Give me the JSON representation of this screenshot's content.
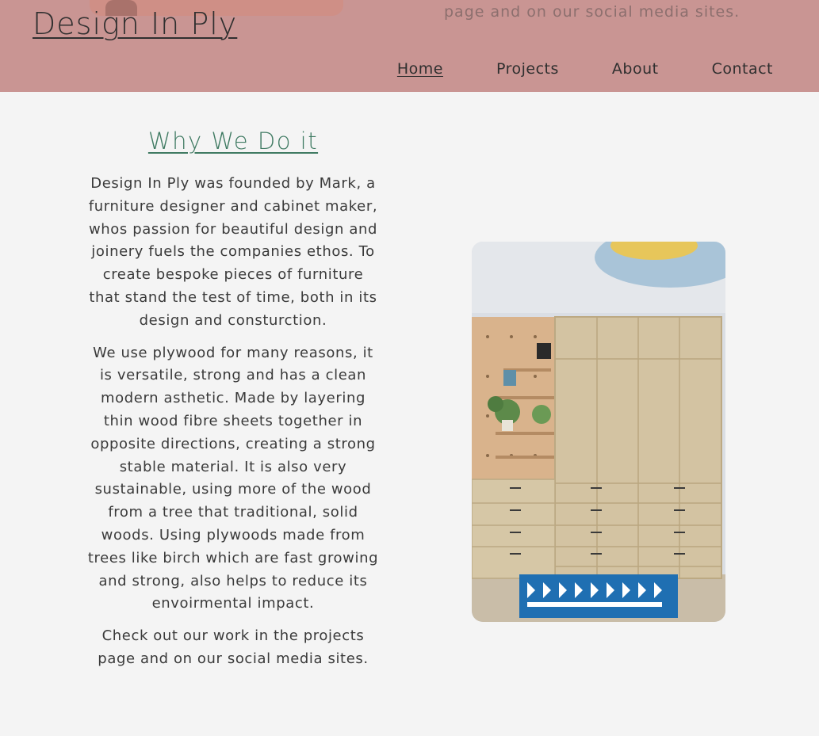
{
  "header": {
    "logo": "Design In Ply",
    "overflow_text": "page and on our social media sites.",
    "nav": [
      {
        "label": "Home",
        "active": true
      },
      {
        "label": "Projects",
        "active": false
      },
      {
        "label": "About",
        "active": false
      },
      {
        "label": "Contact",
        "active": false
      }
    ]
  },
  "main": {
    "title": "Why We Do it",
    "paragraphs": [
      "Design In Ply was founded by Mark, a furniture designer and cabinet maker, whos passion for beautiful design and joinery fuels the companies ethos. To create bespoke pieces of furniture that stand the test of time, both in its design and consturction.",
      "We use plywood for many reasons, it is versatile, strong and has a clean modern asthetic. Made by layering thin wood fibre sheets together in opposite directions, creating a strong stable material. It is also very sustainable, using more of the wood from a tree that traditional, solid woods. Using plywoods made from trees like birch which are fast growing and strong, also helps to reduce its envoirmental impact.",
      "Check out our work in the projects page and on our social media sites."
    ],
    "photo": {
      "subject": "plywood wardrobe with pegboard shelving and blue patterned rug"
    }
  },
  "colors": {
    "header_bg": "#c99593",
    "page_bg": "#f4f4f4",
    "title_green": "#3f7a62",
    "text": "#3a3a3a"
  }
}
